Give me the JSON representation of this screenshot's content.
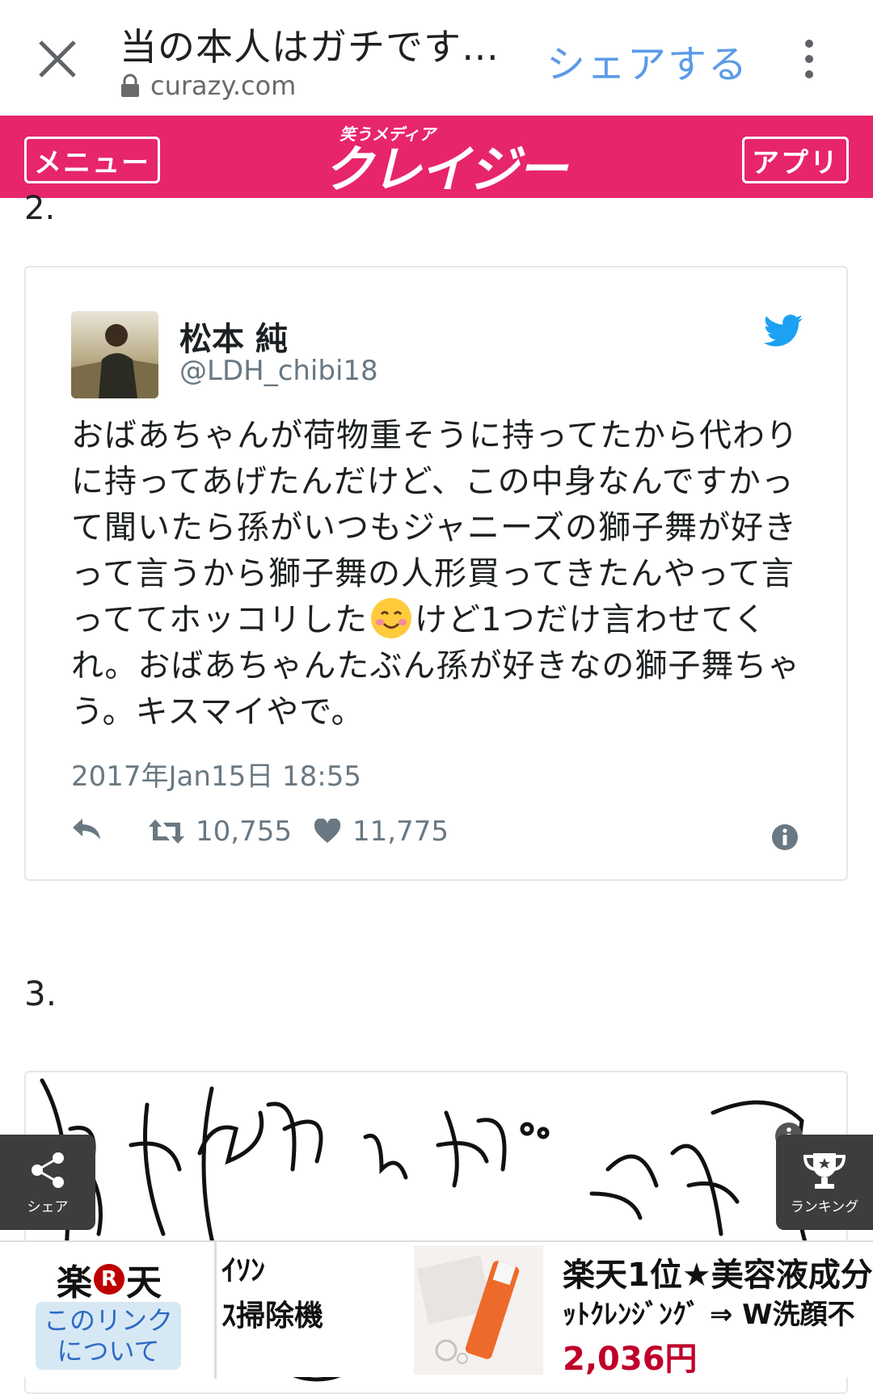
{
  "browser": {
    "title": "当の本人はガチです…",
    "url": "curazy.com",
    "share_label": "シェアする"
  },
  "site_header": {
    "menu_label": "メニュー",
    "app_label": "アプリ",
    "logo_small": "笑うメディア",
    "logo_main": "クレイジー",
    "brand_color": "#e7256b"
  },
  "content": {
    "prev_number": "2.",
    "next_number": "3."
  },
  "tweet": {
    "name": "松本 純",
    "handle": "@LDH_chibi18",
    "text_part1": "おばあちゃんが荷物重そうに持ってたから代わりに持ってあげたんだけど、この中身なんですかって聞いたら孫がいつもジャニーズの獅子舞が好きって言うから獅子舞の人形買ってきたんやって言っててホッコリした",
    "text_part2": "けど1つだけ言わせてくれ。おばあちゃんたぶん孫が好きなの獅子舞ちゃう。キスマイやで。",
    "emoji": "smiling-face-emoji",
    "timestamp": "2017年Jan15日 18:55",
    "retweets": "10,755",
    "likes": "11,775",
    "accent_color": "#1da1f2"
  },
  "floating": {
    "share_label": "シェア",
    "ranking_label": "ランキング"
  },
  "ad": {
    "rakuten_left": "楽",
    "rakuten_r": "R",
    "rakuten_right": "天",
    "about_link_line1": "このリンク",
    "about_link_line2": "について",
    "item1_line1": "ｲｿﾝ",
    "item1_line2": "ｽ掃除機",
    "item2_title": "楽天1位★美容液成分",
    "item2_sub": "ｯﾄｸﾚﾝｼﾞﾝｸﾞ ⇒ W洗顔不",
    "item2_price": "2,036円"
  }
}
